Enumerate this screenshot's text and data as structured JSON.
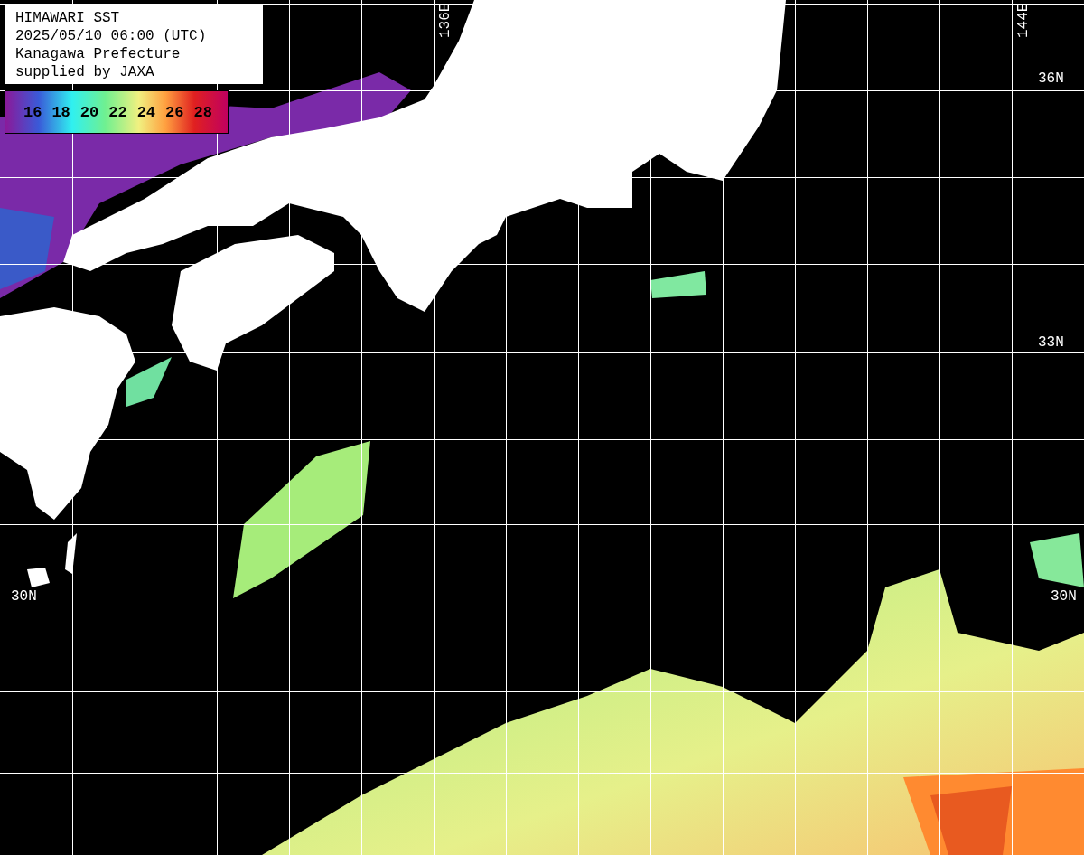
{
  "title_box": {
    "lines": [
      "HIMAWARI SST",
      "2025/05/10 06:00 (UTC)",
      "Kanagawa Prefecture",
      "supplied by JAXA"
    ]
  },
  "legend": {
    "labels": [
      "16",
      "18",
      "20",
      "22",
      "24",
      "26",
      "28"
    ]
  },
  "map": {
    "latitude_labels": [
      "36N",
      "33N",
      "30N",
      "30N"
    ],
    "longitude_labels": [
      "136E",
      "144E"
    ]
  }
}
